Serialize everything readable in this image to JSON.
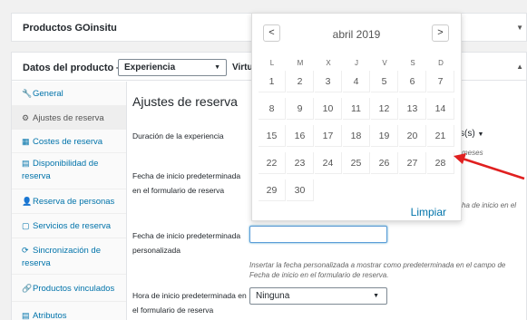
{
  "top_panel": {
    "title": "Productos GOinsitu"
  },
  "product_data": {
    "label": "Datos del producto —",
    "type_value": "Experiencia",
    "virtual_label": "Virtua"
  },
  "sidebar": {
    "items": [
      {
        "label": "General",
        "icon": "wrench-icon",
        "glyph": "🔧"
      },
      {
        "label": "Ajustes de reserva",
        "icon": "gear-icon",
        "glyph": "⚙"
      },
      {
        "label": "Costes de reserva",
        "icon": "table-icon",
        "glyph": "▦"
      },
      {
        "label": "Disponibilidad de reserva",
        "icon": "calendar-icon",
        "glyph": "▤"
      },
      {
        "label": "Reserva de personas",
        "icon": "person-icon",
        "glyph": "👤"
      },
      {
        "label": "Servicios de reserva",
        "icon": "box-icon",
        "glyph": "▢"
      },
      {
        "label": "Sincronización de reserva",
        "icon": "sync-icon",
        "glyph": "⟳"
      },
      {
        "label": "Productos vinculados",
        "icon": "link-icon",
        "glyph": "🔗"
      },
      {
        "label": "Atributos",
        "icon": "list-icon",
        "glyph": "▤"
      }
    ]
  },
  "content": {
    "title": "Ajustes de reserva",
    "duration_label": "Duración de la experiencia",
    "duration_select_partial": "s(s)",
    "duration_hint_partial": "meses",
    "default_start_label": "Fecha de inicio predeterminada en el formulario de reserva",
    "default_start_hint_partial": "ha de inicio en el",
    "custom_start_label": "Fecha de inicio predeterminada personalizada",
    "custom_start_value": "",
    "custom_start_hint": "Insertar la fecha personalizada a mostrar como predeterminada en el campo de Fecha de inicio en el formulario de reserva.",
    "default_time_label": "Hora de inicio predeterminada en el formulario de reserva",
    "default_time_value": "Ninguna"
  },
  "datepicker": {
    "title": "abril 2019",
    "prev": "<",
    "next": ">",
    "weekdays": [
      "L",
      "M",
      "X",
      "J",
      "V",
      "S",
      "D"
    ],
    "weeks": [
      [
        "1",
        "2",
        "3",
        "4",
        "5",
        "6",
        "7"
      ],
      [
        "8",
        "9",
        "10",
        "11",
        "12",
        "13",
        "14"
      ],
      [
        "15",
        "16",
        "17",
        "18",
        "19",
        "20",
        "21"
      ],
      [
        "22",
        "23",
        "24",
        "25",
        "26",
        "27",
        "28"
      ],
      [
        "29",
        "30"
      ]
    ],
    "clear_label": "Limpiar"
  },
  "colors": {
    "accent": "#0073aa",
    "arrow": "#e02020"
  }
}
